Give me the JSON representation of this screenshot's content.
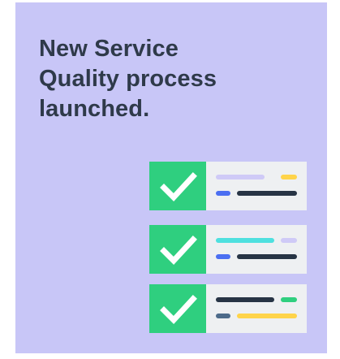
{
  "headline": "New Service\nQuality process\nlaunched.",
  "colors": {
    "card_background": "#c8c6f7",
    "check_tile": "#2fcf7f",
    "line_panel": "#eef0f2",
    "headline_text": "#2f3a4a",
    "bars": {
      "lavender": "#cfcaf7",
      "yellow": "#ffd44a",
      "blue": "#4b6ff2",
      "navy": "#273445",
      "cyan": "#4ee0df",
      "green": "#2fcf7f",
      "slate": "#4d6b8a"
    }
  },
  "icons": {
    "check_row_1": "check-mark-icon",
    "check_row_2": "check-mark-icon",
    "check_row_3": "check-mark-icon"
  }
}
